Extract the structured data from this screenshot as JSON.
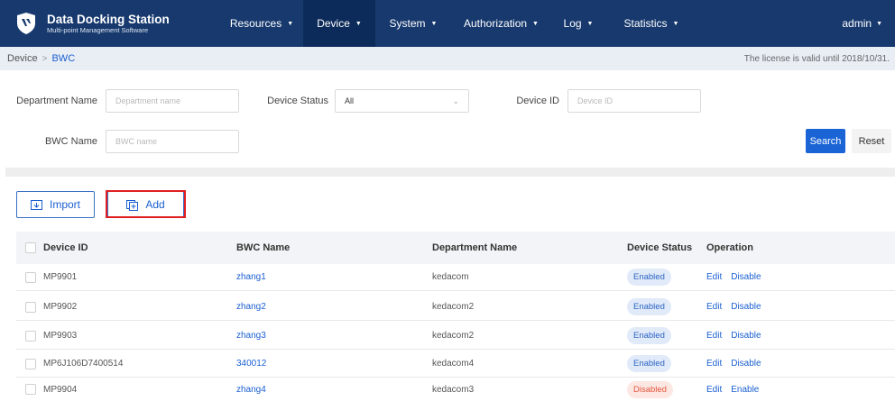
{
  "app": {
    "title": "Data Docking Station",
    "subtitle": "Multi-point Management Software"
  },
  "nav": {
    "items": [
      {
        "label": "Resources"
      },
      {
        "label": "Device"
      },
      {
        "label": "System"
      },
      {
        "label": "Authorization"
      },
      {
        "label": "Log"
      },
      {
        "label": "Statistics"
      }
    ],
    "active": "Device",
    "user": "admin"
  },
  "breadcrumb": {
    "parent": "Device",
    "current": "BWC",
    "separator": ">"
  },
  "license_text": "The license is valid until 2018/10/31.",
  "filters": {
    "department": {
      "label": "Department Name",
      "placeholder": "Department name",
      "value": ""
    },
    "status": {
      "label": "Device Status",
      "value": "All"
    },
    "device_id": {
      "label": "Device ID",
      "placeholder": "Device ID",
      "value": ""
    },
    "bwc_name": {
      "label": "BWC Name",
      "placeholder": "BWC name",
      "value": ""
    },
    "search_label": "Search",
    "reset_label": "Reset"
  },
  "actions": {
    "import_label": "Import",
    "add_label": "Add"
  },
  "table": {
    "headers": {
      "device_id": "Device ID",
      "bwc_name": "BWC Name",
      "department": "Department Name",
      "status": "Device Status",
      "operation": "Operation"
    },
    "rows": [
      {
        "device_id": "MP9901",
        "bwc_name": "zhang1",
        "department": "kedacom",
        "status": "Enabled",
        "op1": "Edit",
        "op2": "Disable"
      },
      {
        "device_id": "MP9902",
        "bwc_name": "zhang2",
        "department": "kedacom2",
        "status": "Enabled",
        "op1": "Edit",
        "op2": "Disable"
      },
      {
        "device_id": "MP9903",
        "bwc_name": "zhang3",
        "department": "kedacom2",
        "status": "Enabled",
        "op1": "Edit",
        "op2": "Disable"
      },
      {
        "device_id": "MP6J106D7400514",
        "bwc_name": "340012",
        "department": "kedacom4",
        "status": "Enabled",
        "op1": "Edit",
        "op2": "Disable"
      },
      {
        "device_id": "MP9904",
        "bwc_name": "zhang4",
        "department": "kedacom3",
        "status": "Disabled",
        "op1": "Edit",
        "op2": "Enable"
      }
    ]
  },
  "colors": {
    "nav_bg": "#17396e",
    "nav_active": "#0d2b5a",
    "primary": "#1a64d6",
    "link": "#1a5fd1",
    "highlight": "#e02020",
    "enabled_bg": "#e1eaf8",
    "disabled_bg": "#fde7e3"
  },
  "icons": {
    "logo": "shield-logo-icon",
    "import": "import-folder-icon",
    "add": "add-copy-icon",
    "dropdown": "caret-down-icon",
    "select": "chevron-down-icon"
  }
}
